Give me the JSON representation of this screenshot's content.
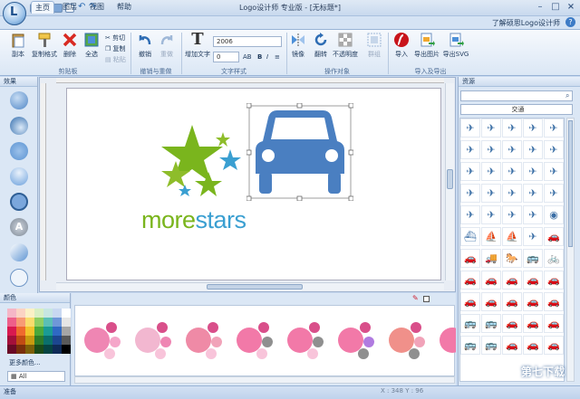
{
  "window": {
    "title": "Logo设计师 专业版 - [无标题*]",
    "help_link": "了解硕思Logo设计师"
  },
  "tabs": [
    "主页",
    "图层",
    "视图",
    "帮助"
  ],
  "ribbon": {
    "clipboard": {
      "label": "剪贴板",
      "paste": "副本",
      "copy_format": "复制格式",
      "delete": "删除",
      "select_all": "全选",
      "cut": "剪切",
      "copy": "复制",
      "paste_small": "粘贴"
    },
    "undo_redo": {
      "label": "撤销与重做",
      "undo": "撤销",
      "redo": "重做"
    },
    "text_style": {
      "label": "文字样式",
      "add_text": "增加文字",
      "font_value": "2006",
      "size_value": "0",
      "ab_label": "AB"
    },
    "operate": {
      "label": "操作对象",
      "mirror": "镜像",
      "flip": "翻转",
      "opacity": "不透明度",
      "group": "群组"
    },
    "import_export": {
      "label": "导入及导出",
      "import": "导入",
      "export_image": "导出图片",
      "export_svg": "导出SVG"
    }
  },
  "effects_panel": {
    "title": "效果"
  },
  "canvas": {
    "logo_text_part1": "more",
    "logo_text_part2": "stars",
    "logo_color_green": "#7ab51d",
    "logo_color_blue": "#3a9fd1",
    "car_color": "#4a7fc1"
  },
  "colors_panel": {
    "title": "颜色",
    "more_colors": "更多颜色...",
    "filter_value": "All",
    "swatches": [
      "#f5b6c7",
      "#fbd3c4",
      "#fbf1c6",
      "#d8efc3",
      "#c7e6e2",
      "#c9d8f1",
      "#ffffff",
      "#ee5f8a",
      "#f79b75",
      "#f9dc6d",
      "#8ece63",
      "#5bbfb6",
      "#6f97d8",
      "#e6e6e6",
      "#d8194f",
      "#ef6a2e",
      "#f2c32b",
      "#4aa83b",
      "#1a9b95",
      "#2f69c3",
      "#a6a6a6",
      "#a3103a",
      "#c04b14",
      "#c89a10",
      "#2e7b28",
      "#0b6f6c",
      "#1c4690",
      "#595959",
      "#6a0a26",
      "#7a2f0b",
      "#7d5f09",
      "#1b4a18",
      "#064442",
      "#0f2a57",
      "#000000"
    ]
  },
  "library_panel": {
    "title": "资源",
    "category": "交通",
    "search_placeholder": ""
  },
  "status": {
    "ready": "准备",
    "coords": "X : 348    Y : 96",
    "watermark": "第七下载"
  }
}
